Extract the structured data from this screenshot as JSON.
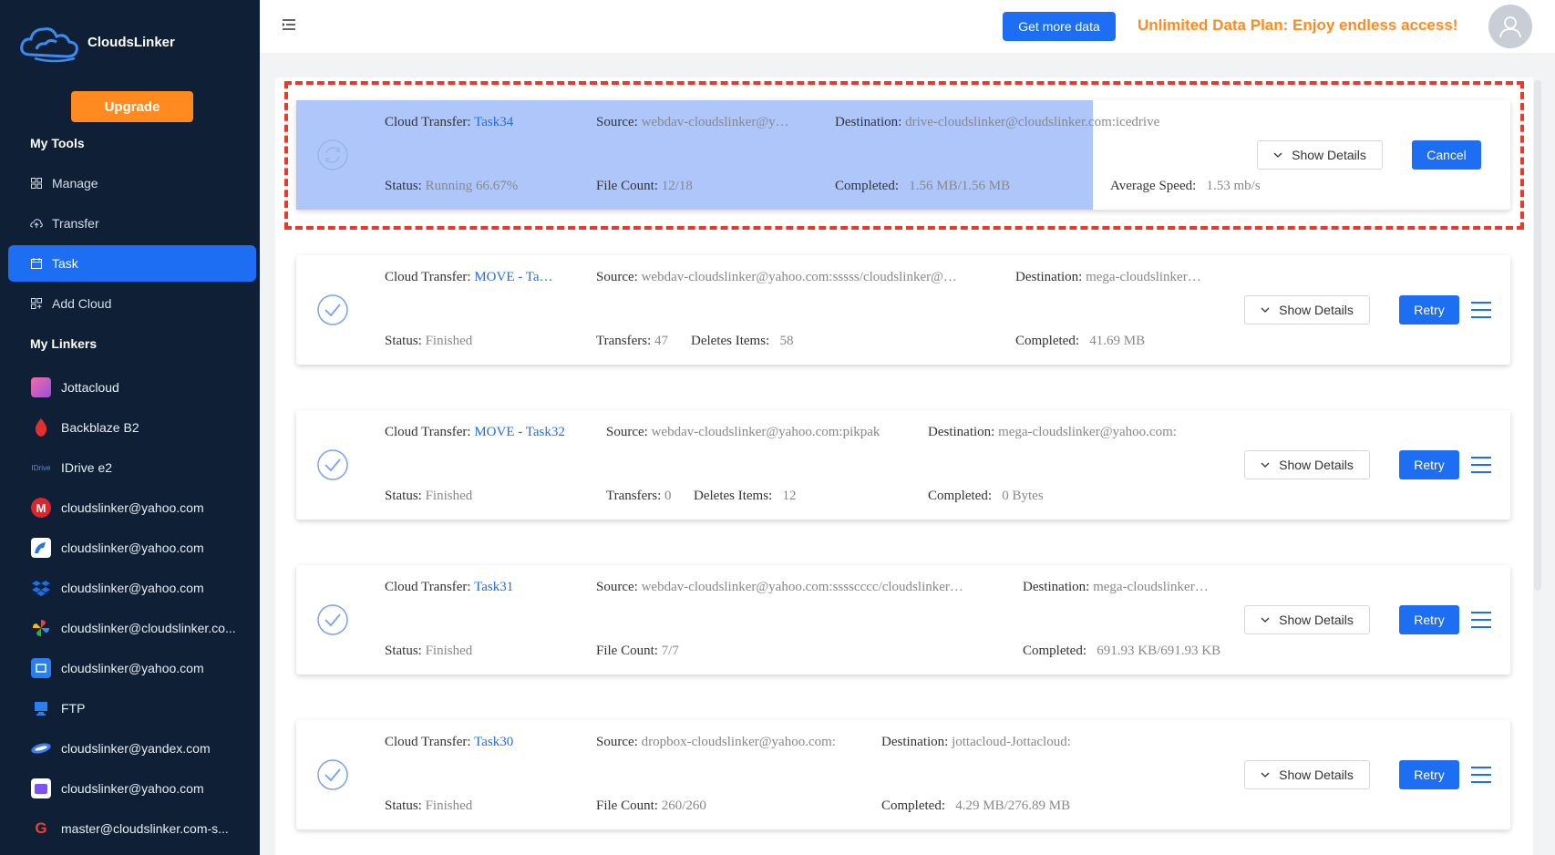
{
  "app": {
    "name": "CloudsLinker"
  },
  "sidebar": {
    "upgrade_label": "Upgrade",
    "tools_title": "My Tools",
    "tools": [
      {
        "label": "Manage",
        "icon": "grid-icon"
      },
      {
        "label": "Transfer",
        "icon": "cloud-transfer-icon"
      },
      {
        "label": "Task",
        "icon": "calendar-icon",
        "active": true
      },
      {
        "label": "Add Cloud",
        "icon": "add-grid-icon"
      }
    ],
    "linkers_title": "My Linkers",
    "linkers": [
      {
        "label": "Jottacloud",
        "icon": "jottacloud-icon",
        "color": "#c94fd0"
      },
      {
        "label": "Backblaze B2",
        "icon": "backblaze-icon",
        "color": "#e0312f"
      },
      {
        "label": "IDrive e2",
        "icon": "idrive-icon",
        "color": "#2560c9"
      },
      {
        "label": "cloudslinker@yahoo.com",
        "icon": "mega-icon",
        "color": "#d9272e"
      },
      {
        "label": "cloudslinker@yahoo.com",
        "icon": "pikpak-icon",
        "color": "#2b74d8"
      },
      {
        "label": "cloudslinker@yahoo.com",
        "icon": "dropbox-icon",
        "color": "#1a6ee8"
      },
      {
        "label": "cloudslinker@cloudslinker.co...",
        "icon": "google-photos-icon",
        "color": "#f4b400"
      },
      {
        "label": "cloudslinker@yahoo.com",
        "icon": "box-icon",
        "color": "#2a7ff0"
      },
      {
        "label": "FTP",
        "icon": "ftp-icon",
        "color": "#2a7ff0"
      },
      {
        "label": "cloudslinker@yandex.com",
        "icon": "yandex-disk-icon",
        "color": "#3b7bf3"
      },
      {
        "label": "cloudslinker@yahoo.com",
        "icon": "proton-drive-icon",
        "color": "#7b54f0"
      },
      {
        "label": "master@cloudslinker.com-s...",
        "icon": "google-icon",
        "color": "#ea4335"
      }
    ]
  },
  "header": {
    "get_data_label": "Get more data",
    "promo_text": "Unlimited Data Plan: Enjoy endless access!"
  },
  "labels": {
    "cloud_transfer": "Cloud Transfer:",
    "source": "Source:",
    "destination": "Destination:",
    "status": "Status:",
    "file_count": "File Count:",
    "completed": "Completed:",
    "average_speed": "Average Speed:",
    "transfers": "Transfers:",
    "deletes_items": "Deletes Items:",
    "show_details": "Show Details",
    "cancel": "Cancel",
    "retry": "Retry"
  },
  "tasks": [
    {
      "name": "Task34",
      "source": "webdav-cloudslinker@y…",
      "destination": "drive-cloudslinker@cloudslinker.com:icedrive",
      "status": "Running 66.67%",
      "file_count": "12/18",
      "completed": "1.56 MB/1.56 MB",
      "average_speed": "1.53 mb/s",
      "progress": 0.6667
    },
    {
      "name": "MOVE - Ta…",
      "source": "webdav-cloudslinker@yahoo.com:sssss/cloudslinker@…",
      "destination": "mega-cloudslinker…",
      "status": "Finished",
      "transfers": "47",
      "deletes_items": "58",
      "completed": "41.69 MB"
    },
    {
      "name": "MOVE - Task32",
      "source": "webdav-cloudslinker@yahoo.com:pikpak",
      "destination": "mega-cloudslinker@yahoo.com:",
      "status": "Finished",
      "transfers": "0",
      "deletes_items": "12",
      "completed": "0 Bytes"
    },
    {
      "name": "Task31",
      "source": "webdav-cloudslinker@yahoo.com:sssscccc/cloudslinker…",
      "destination": "mega-cloudslinker…",
      "status": "Finished",
      "file_count": "7/7",
      "completed": "691.93 KB/691.93 KB"
    },
    {
      "name": "Task30",
      "source": "dropbox-cloudslinker@yahoo.com:",
      "destination": "jottacloud-Jottacloud:",
      "status": "Finished",
      "file_count": "260/260",
      "completed": "4.29 MB/276.89 MB"
    }
  ]
}
